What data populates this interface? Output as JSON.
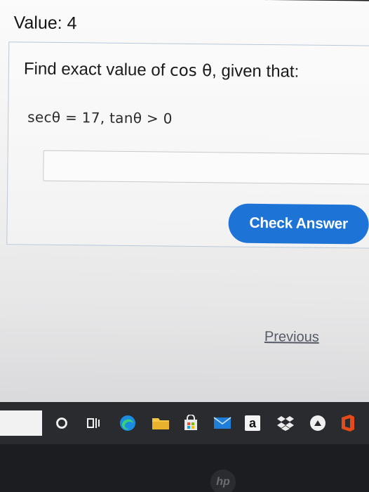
{
  "header": {
    "value_label": "Value: 4"
  },
  "question": {
    "prompt_text": "Find exact value of ",
    "prompt_math": "cos θ",
    "prompt_suffix": ", given that:",
    "equation": "secθ  =  17, tanθ  > 0"
  },
  "answer": {
    "value": "",
    "placeholder": ""
  },
  "buttons": {
    "check_answer": "Check Answer",
    "previous": "Previous"
  },
  "taskbar": {
    "icons": [
      "cortana-icon",
      "task-view-icon",
      "edge-icon",
      "file-explorer-icon",
      "store-icon",
      "mail-icon",
      "amazon-icon",
      "dropbox-icon",
      "app-icon",
      "office-icon"
    ],
    "amazon_letter": "a"
  },
  "device": {
    "logo": "hp"
  },
  "colors": {
    "accent": "#1d73d6",
    "card_border": "#b9c8d8",
    "taskbar": "#2a2b2e"
  }
}
